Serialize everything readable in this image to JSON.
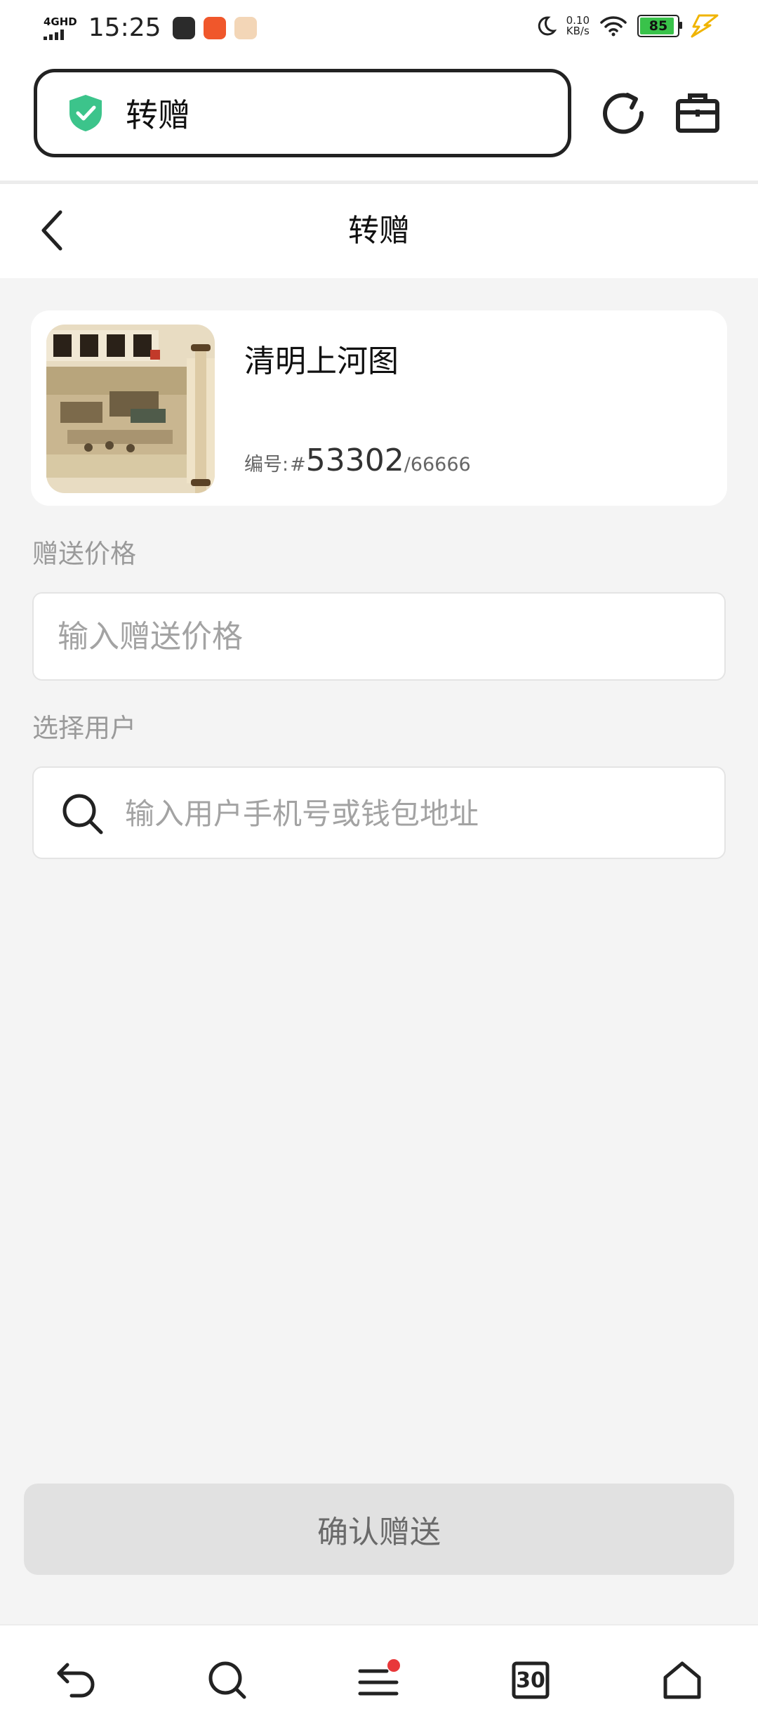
{
  "status_bar": {
    "network": "4GHD",
    "time": "15:25",
    "net_speed_value": "0.10",
    "net_speed_unit": "KB/s",
    "battery_level": "85"
  },
  "browser": {
    "url_text": "转赠",
    "secure_color": "#3cc48b"
  },
  "header": {
    "title": "转赠"
  },
  "nft": {
    "name": "清明上河图",
    "serial_label": "编号:",
    "serial_prefix": "#",
    "serial_number": "53302",
    "serial_total": "/66666"
  },
  "price_section": {
    "label": "赠送价格",
    "placeholder": "输入赠送价格"
  },
  "user_section": {
    "label": "选择用户",
    "placeholder": "输入用户手机号或钱包地址"
  },
  "confirm_button": {
    "label": "确认赠送"
  },
  "bottom_nav": {
    "tab_count": "30",
    "menu_badge_color": "#e8383a"
  }
}
